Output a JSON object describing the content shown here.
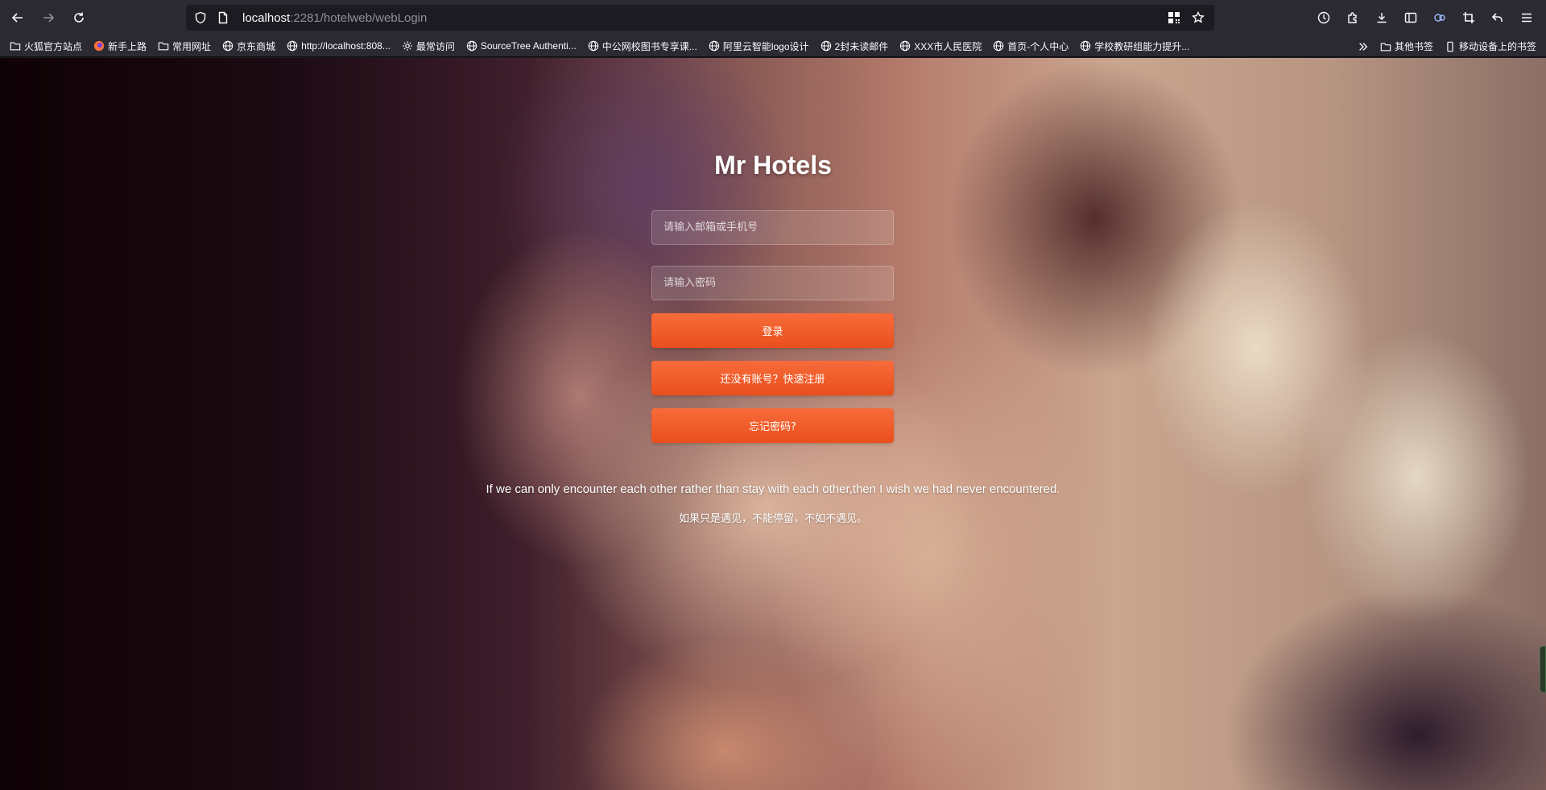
{
  "browser": {
    "url_host": "localhost",
    "url_rest": ":2281/hotelweb/webLogin",
    "bookmarks": [
      {
        "label": "火狐官方站点",
        "icon": "folder-icon"
      },
      {
        "label": "新手上路",
        "icon": "firefox-icon"
      },
      {
        "label": "常用网址",
        "icon": "folder-icon"
      },
      {
        "label": "京东商城",
        "icon": "globe-icon"
      },
      {
        "label": "http://localhost:808...",
        "icon": "globe-icon"
      },
      {
        "label": "最常访问",
        "icon": "gear-icon"
      },
      {
        "label": "SourceTree Authenti...",
        "icon": "globe-icon"
      },
      {
        "label": "中公网校图书专享课...",
        "icon": "globe-icon"
      },
      {
        "label": "阿里云智能logo设计",
        "icon": "globe-icon"
      },
      {
        "label": "2封未读邮件",
        "icon": "globe-icon"
      },
      {
        "label": "XXX市人民医院",
        "icon": "globe-icon"
      },
      {
        "label": "首页-个人中心",
        "icon": "globe-icon"
      },
      {
        "label": "学校教研组能力提升...",
        "icon": "globe-icon"
      }
    ],
    "other_bookmarks": "其他书签",
    "mobile_bookmarks": "移动设备上的书签"
  },
  "login": {
    "brand": "Mr Hotels",
    "account_placeholder": "请输入邮箱或手机号",
    "password_placeholder": "请输入密码",
    "login_label": "登录",
    "register_label": "还没有账号？快速注册",
    "forgot_label": "忘记密码?"
  },
  "quote": {
    "en": "If we can only encounter each other rather than stay with each other,then I wish we had never encountered.",
    "cn": "如果只是遇见，不能停留，不如不遇见。"
  }
}
